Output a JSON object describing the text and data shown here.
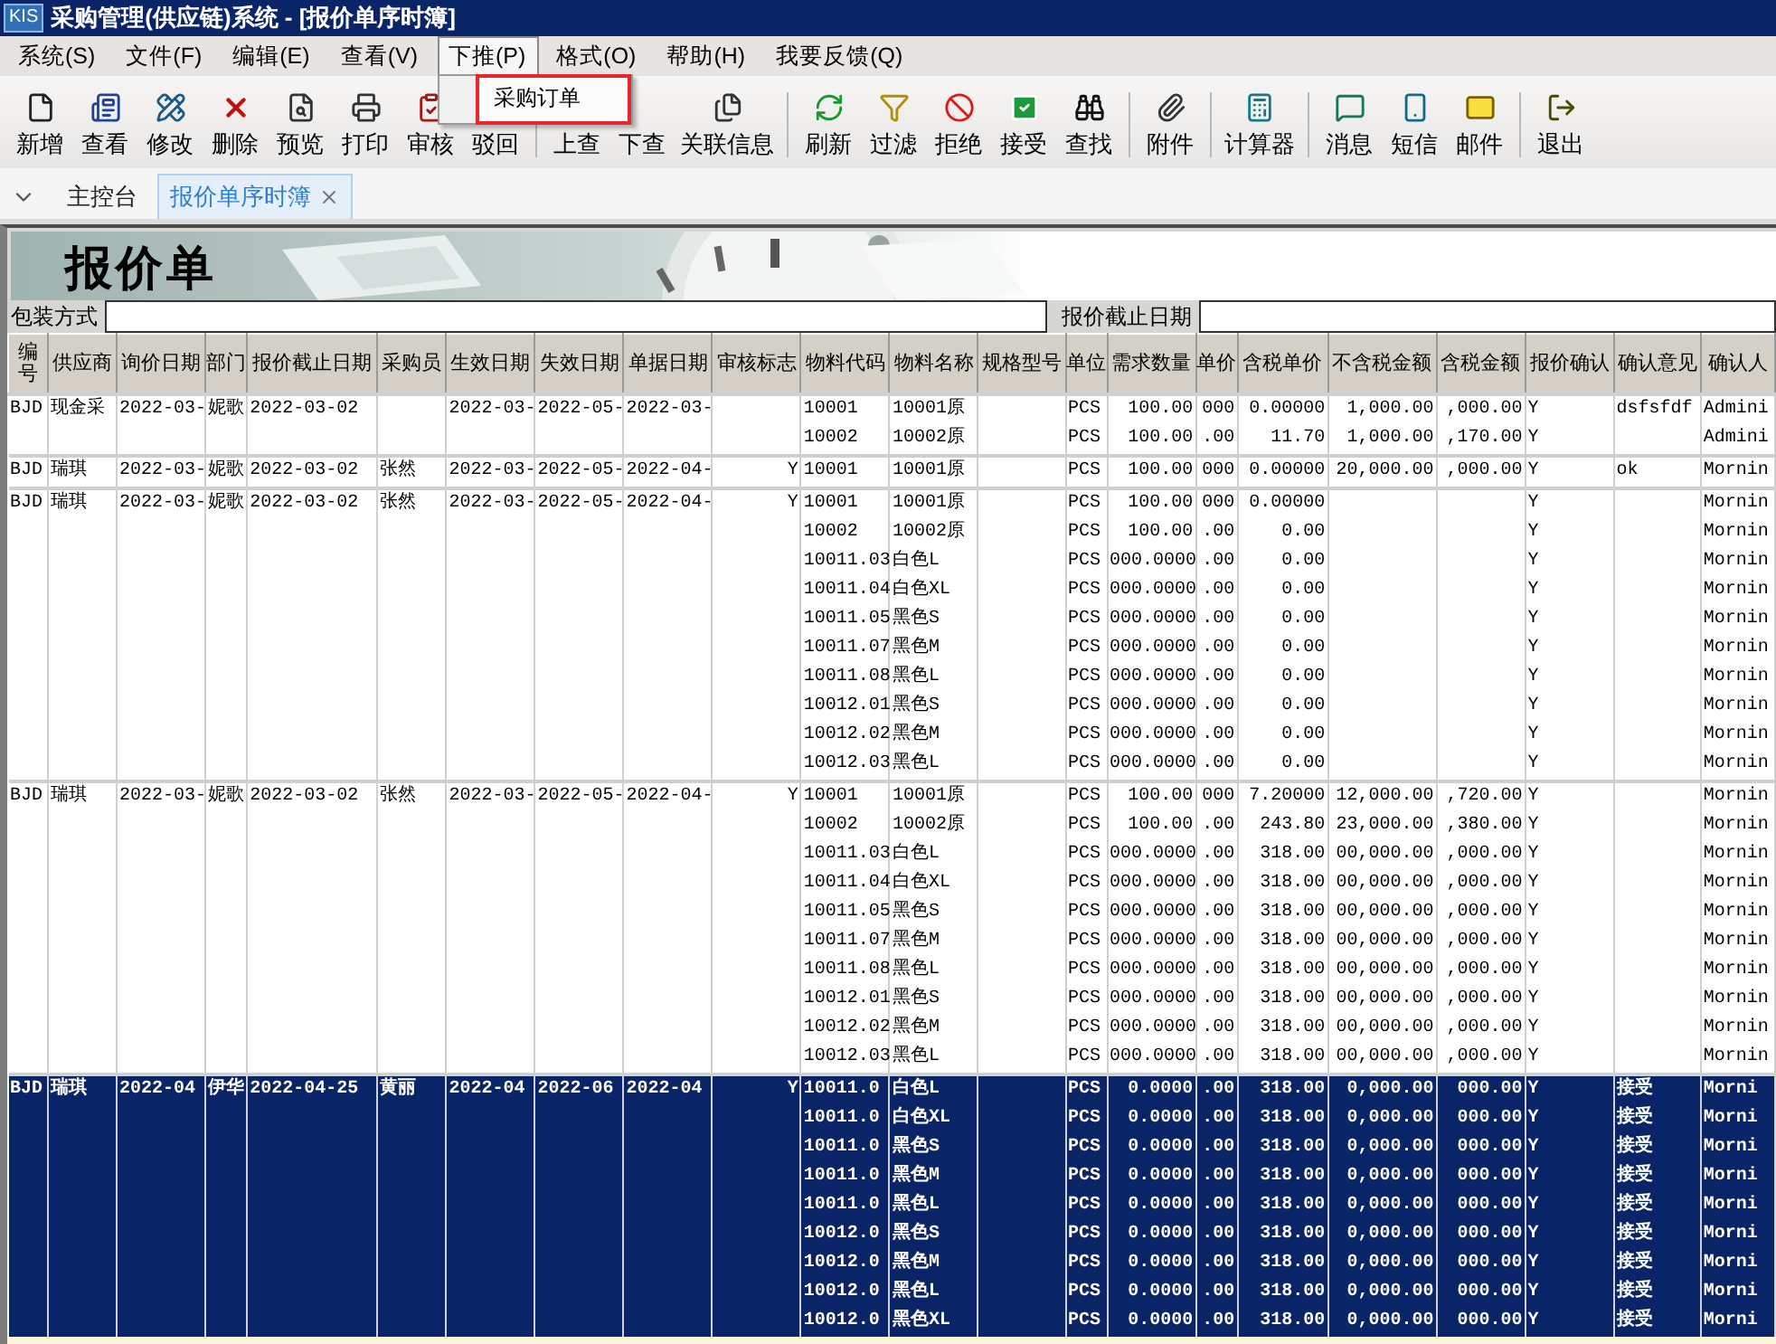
{
  "window": {
    "logo_text": "KIS",
    "title": "采购管理(供应链)系统 - [报价单序时簿]"
  },
  "menu": [
    {
      "label": "系统(S)",
      "selected": false
    },
    {
      "label": "文件(F)",
      "selected": false
    },
    {
      "label": "编辑(E)",
      "selected": false
    },
    {
      "label": "查看(V)",
      "selected": false
    },
    {
      "label": "下推(P)",
      "selected": true,
      "dropdown": [
        {
          "label": "采购订单",
          "highlighted": true
        }
      ]
    },
    {
      "label": "格式(O)",
      "selected": false
    },
    {
      "label": "帮助(H)",
      "selected": false
    },
    {
      "label": "我要反馈(Q)",
      "selected": false
    }
  ],
  "toolbar": [
    {
      "label": "新增"
    },
    {
      "label": "查看"
    },
    {
      "label": "修改"
    },
    {
      "label": "删除"
    },
    {
      "label": "预览"
    },
    {
      "label": "打印"
    },
    {
      "label": "审核"
    },
    {
      "label": "驳回",
      "separator_after": true
    },
    {
      "label": "上查"
    },
    {
      "label": "下查"
    },
    {
      "label": "关联信息",
      "separator_after": true
    },
    {
      "label": "刷新"
    },
    {
      "label": "过滤"
    },
    {
      "label": "拒绝"
    },
    {
      "label": "接受"
    },
    {
      "label": "查找",
      "separator_after": true
    },
    {
      "label": "附件",
      "separator_after": true
    },
    {
      "label": "计算器",
      "separator_after": true
    },
    {
      "label": "消息"
    },
    {
      "label": "短信"
    },
    {
      "label": "邮件",
      "separator_after": true
    },
    {
      "label": "退出"
    }
  ],
  "tabs": [
    {
      "label": "主控台",
      "selected": false,
      "closable": false
    },
    {
      "label": "报价单序时簿",
      "selected": true,
      "closable": true
    }
  ],
  "banner": {
    "title": "报价单"
  },
  "filters": [
    {
      "label": "包装方式"
    },
    {
      "label": "报价截止日期"
    }
  ],
  "table": {
    "columns": [
      "编号",
      "供应商",
      "询价日期",
      "部门",
      "报价截止日期",
      "采购员",
      "生效日期",
      "失效日期",
      "单据日期",
      "审核标志",
      "物料代码",
      "物料名称",
      "规格型号",
      "单位",
      "需求数量",
      "单价",
      "含税单价",
      "不含税金额",
      "含税金额",
      "报价确认",
      "确认意见",
      "确认人"
    ],
    "groups": [
      {
        "selected": false,
        "number": "BJD",
        "supplier": "现金采",
        "inquiry_date": "2022-03-",
        "department": "妮歌",
        "deadline": "2022-03-02",
        "effective_date": "2022-03-",
        "expiry_date": "2022-05-",
        "doc_date": "2022-03-",
        "lines": [
          {
            "code": "10001",
            "name": "10001原",
            "unit": "PCS",
            "qty": "100.00",
            "price": "000",
            "tax_price": "0.00000",
            "net_amount": "1,000.00",
            "tax_amount": ",000.00",
            "confirm": "Y",
            "opinion": "dsfsfdf",
            "confirmer": "Admini"
          },
          {
            "code": "10002",
            "name": "10002原",
            "unit": "PCS",
            "qty": "100.00",
            "price": ".00",
            "tax_price": "11.70",
            "net_amount": "1,000.00",
            "tax_amount": ",170.00",
            "confirm": "Y",
            "confirmer": "Admini"
          }
        ]
      },
      {
        "selected": false,
        "number": "BJD",
        "supplier": "瑞琪",
        "inquiry_date": "2022-03-",
        "department": "妮歌",
        "deadline": "2022-03-02",
        "buyer": "张然",
        "effective_date": "2022-03-",
        "expiry_date": "2022-05-",
        "doc_date": "2022-04-",
        "audit_flag": "Y",
        "lines": [
          {
            "code": "10001",
            "name": "10001原",
            "unit": "PCS",
            "qty": "100.00",
            "price": "000",
            "tax_price": "0.00000",
            "net_amount": "20,000.00",
            "tax_amount": ",000.00",
            "confirm": "Y",
            "opinion": "ok",
            "confirmer": "Mornin"
          }
        ]
      },
      {
        "selected": false,
        "number": "BJD",
        "supplier": "瑞琪",
        "inquiry_date": "2022-03-",
        "department": "妮歌",
        "deadline": "2022-03-02",
        "buyer": "张然",
        "effective_date": "2022-03-",
        "expiry_date": "2022-05-",
        "doc_date": "2022-04-",
        "audit_flag": "Y",
        "lines": [
          {
            "code": "10001",
            "name": "10001原",
            "unit": "PCS",
            "qty": "100.00",
            "price": "000",
            "tax_price": "0.00000",
            "confirm": "Y",
            "confirmer": "Mornin"
          },
          {
            "code": "10002",
            "name": "10002原",
            "unit": "PCS",
            "qty": "100.00",
            "price": ".00",
            "tax_price": "0.00",
            "confirm": "Y",
            "confirmer": "Mornin"
          },
          {
            "code": "10011.03",
            "name": "白色L",
            "unit": "PCS",
            "qty": "000.0000",
            "price": ".00",
            "tax_price": "0.00",
            "confirm": "Y",
            "confirmer": "Mornin"
          },
          {
            "code": "10011.04",
            "name": "白色XL",
            "unit": "PCS",
            "qty": "000.0000",
            "price": ".00",
            "tax_price": "0.00",
            "confirm": "Y",
            "confirmer": "Mornin"
          },
          {
            "code": "10011.05",
            "name": "黑色S",
            "unit": "PCS",
            "qty": "000.0000",
            "price": ".00",
            "tax_price": "0.00",
            "confirm": "Y",
            "confirmer": "Mornin"
          },
          {
            "code": "10011.07",
            "name": "黑色M",
            "unit": "PCS",
            "qty": "000.0000",
            "price": ".00",
            "tax_price": "0.00",
            "confirm": "Y",
            "confirmer": "Mornin"
          },
          {
            "code": "10011.08",
            "name": "黑色L",
            "unit": "PCS",
            "qty": "000.0000",
            "price": ".00",
            "tax_price": "0.00",
            "confirm": "Y",
            "confirmer": "Mornin"
          },
          {
            "code": "10012.01",
            "name": "黑色S",
            "unit": "PCS",
            "qty": "000.0000",
            "price": ".00",
            "tax_price": "0.00",
            "confirm": "Y",
            "confirmer": "Mornin"
          },
          {
            "code": "10012.02",
            "name": "黑色M",
            "unit": "PCS",
            "qty": "000.0000",
            "price": ".00",
            "tax_price": "0.00",
            "confirm": "Y",
            "confirmer": "Mornin"
          },
          {
            "code": "10012.03",
            "name": "黑色L",
            "unit": "PCS",
            "qty": "000.0000",
            "price": ".00",
            "tax_price": "0.00",
            "confirm": "Y",
            "confirmer": "Mornin"
          }
        ]
      },
      {
        "selected": false,
        "number": "BJD",
        "supplier": "瑞琪",
        "inquiry_date": "2022-03-",
        "department": "妮歌",
        "deadline": "2022-03-02",
        "buyer": "张然",
        "effective_date": "2022-03-",
        "expiry_date": "2022-05-",
        "doc_date": "2022-04-",
        "audit_flag": "Y",
        "lines": [
          {
            "code": "10001",
            "name": "10001原",
            "unit": "PCS",
            "qty": "100.00",
            "price": "000",
            "tax_price": "7.20000",
            "net_amount": "12,000.00",
            "tax_amount": ",720.00",
            "confirm": "Y",
            "confirmer": "Mornin"
          },
          {
            "code": "10002",
            "name": "10002原",
            "unit": "PCS",
            "qty": "100.00",
            "price": ".00",
            "tax_price": "243.80",
            "net_amount": "23,000.00",
            "tax_amount": ",380.00",
            "confirm": "Y",
            "confirmer": "Mornin"
          },
          {
            "code": "10011.03",
            "name": "白色L",
            "unit": "PCS",
            "qty": "000.0000",
            "price": ".00",
            "tax_price": "318.00",
            "net_amount": "00,000.00",
            "tax_amount": ",000.00",
            "confirm": "Y",
            "confirmer": "Mornin"
          },
          {
            "code": "10011.04",
            "name": "白色XL",
            "unit": "PCS",
            "qty": "000.0000",
            "price": ".00",
            "tax_price": "318.00",
            "net_amount": "00,000.00",
            "tax_amount": ",000.00",
            "confirm": "Y",
            "confirmer": "Mornin"
          },
          {
            "code": "10011.05",
            "name": "黑色S",
            "unit": "PCS",
            "qty": "000.0000",
            "price": ".00",
            "tax_price": "318.00",
            "net_amount": "00,000.00",
            "tax_amount": ",000.00",
            "confirm": "Y",
            "confirmer": "Mornin"
          },
          {
            "code": "10011.07",
            "name": "黑色M",
            "unit": "PCS",
            "qty": "000.0000",
            "price": ".00",
            "tax_price": "318.00",
            "net_amount": "00,000.00",
            "tax_amount": ",000.00",
            "confirm": "Y",
            "confirmer": "Mornin"
          },
          {
            "code": "10011.08",
            "name": "黑色L",
            "unit": "PCS",
            "qty": "000.0000",
            "price": ".00",
            "tax_price": "318.00",
            "net_amount": "00,000.00",
            "tax_amount": ",000.00",
            "confirm": "Y",
            "confirmer": "Mornin"
          },
          {
            "code": "10012.01",
            "name": "黑色S",
            "unit": "PCS",
            "qty": "000.0000",
            "price": ".00",
            "tax_price": "318.00",
            "net_amount": "00,000.00",
            "tax_amount": ",000.00",
            "confirm": "Y",
            "confirmer": "Mornin"
          },
          {
            "code": "10012.02",
            "name": "黑色M",
            "unit": "PCS",
            "qty": "000.0000",
            "price": ".00",
            "tax_price": "318.00",
            "net_amount": "00,000.00",
            "tax_amount": ",000.00",
            "confirm": "Y",
            "confirmer": "Mornin"
          },
          {
            "code": "10012.03",
            "name": "黑色L",
            "unit": "PCS",
            "qty": "000.0000",
            "price": ".00",
            "tax_price": "318.00",
            "net_amount": "00,000.00",
            "tax_amount": ",000.00",
            "confirm": "Y",
            "confirmer": "Mornin"
          }
        ]
      },
      {
        "selected": true,
        "number": "BJD",
        "supplier": "瑞琪",
        "inquiry_date": "2022-04",
        "department": "伊华",
        "deadline": "2022-04-25",
        "buyer": "黄丽",
        "effective_date": "2022-04",
        "expiry_date": "2022-06",
        "doc_date": "2022-04",
        "audit_flag": "Y",
        "lines": [
          {
            "code": "10011.0",
            "name": "白色L",
            "unit": "PCS",
            "qty": "0.0000",
            "price": ".00",
            "tax_price": "318.00",
            "net_amount": "0,000.00",
            "tax_amount": "000.00",
            "confirm": "Y",
            "opinion": "接受",
            "confirmer": "Morni"
          },
          {
            "code": "10011.0",
            "name": "白色XL",
            "unit": "PCS",
            "qty": "0.0000",
            "price": ".00",
            "tax_price": "318.00",
            "net_amount": "0,000.00",
            "tax_amount": "000.00",
            "confirm": "Y",
            "opinion": "接受",
            "confirmer": "Morni"
          },
          {
            "code": "10011.0",
            "name": "黑色S",
            "unit": "PCS",
            "qty": "0.0000",
            "price": ".00",
            "tax_price": "318.00",
            "net_amount": "0,000.00",
            "tax_amount": "000.00",
            "confirm": "Y",
            "opinion": "接受",
            "confirmer": "Morni"
          },
          {
            "code": "10011.0",
            "name": "黑色M",
            "unit": "PCS",
            "qty": "0.0000",
            "price": ".00",
            "tax_price": "318.00",
            "net_amount": "0,000.00",
            "tax_amount": "000.00",
            "confirm": "Y",
            "opinion": "接受",
            "confirmer": "Morni"
          },
          {
            "code": "10011.0",
            "name": "黑色L",
            "unit": "PCS",
            "qty": "0.0000",
            "price": ".00",
            "tax_price": "318.00",
            "net_amount": "0,000.00",
            "tax_amount": "000.00",
            "confirm": "Y",
            "opinion": "接受",
            "confirmer": "Morni"
          },
          {
            "code": "10012.0",
            "name": "黑色S",
            "unit": "PCS",
            "qty": "0.0000",
            "price": ".00",
            "tax_price": "318.00",
            "net_amount": "0,000.00",
            "tax_amount": "000.00",
            "confirm": "Y",
            "opinion": "接受",
            "confirmer": "Morni"
          },
          {
            "code": "10012.0",
            "name": "黑色M",
            "unit": "PCS",
            "qty": "0.0000",
            "price": ".00",
            "tax_price": "318.00",
            "net_amount": "0,000.00",
            "tax_amount": "000.00",
            "confirm": "Y",
            "opinion": "接受",
            "confirmer": "Morni"
          },
          {
            "code": "10012.0",
            "name": "黑色L",
            "unit": "PCS",
            "qty": "0.0000",
            "price": ".00",
            "tax_price": "318.00",
            "net_amount": "0,000.00",
            "tax_amount": "000.00",
            "confirm": "Y",
            "opinion": "接受",
            "confirmer": "Morni"
          },
          {
            "code": "10012.0",
            "name": "黑色XL",
            "unit": "PCS",
            "qty": "0.0000",
            "price": ".00",
            "tax_price": "318.00",
            "net_amount": "0,000.00",
            "tax_amount": "000.00",
            "confirm": "Y",
            "opinion": "接受",
            "confirmer": "Morni"
          }
        ]
      }
    ]
  }
}
